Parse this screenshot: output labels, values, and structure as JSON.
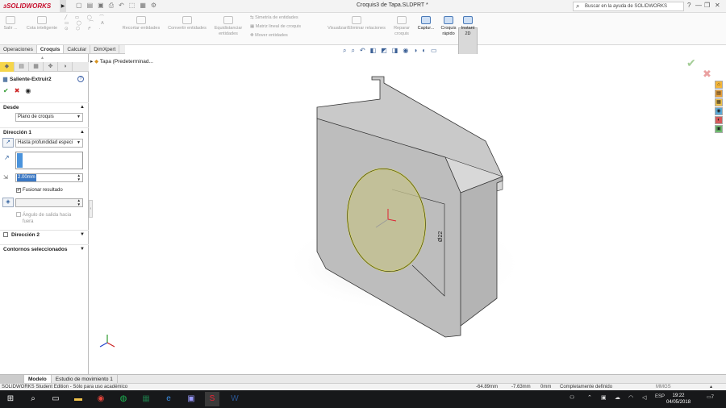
{
  "app": {
    "title": "Croquis3 de Tapa.SLDPRT *",
    "logo": "SOLIDWORKS"
  },
  "help_search": {
    "placeholder": "Buscar en la ayuda de SOLIDWORKS"
  },
  "ribbon": {
    "buttons": [
      "Salir ...",
      "Cota inteligente",
      "Recortar entidades",
      "Convertir entidades",
      "Equidistanciar entidades",
      "Simetría de entidades",
      "Matriz lineal de croquis",
      "Mover entidades",
      "Visualizar/Eliminar relaciones",
      "Reparar croquis",
      "Captur...",
      "Croquis rápido",
      "Instant 2D"
    ]
  },
  "tabs": [
    "Operaciones",
    "Croquis",
    "Calcular",
    "DimXpert"
  ],
  "active_tab": "Croquis",
  "panel": {
    "feature_title": "Saliente-Extruir2",
    "desde_label": "Desde",
    "desde_value": "Plano de croquis",
    "direccion1_label": "Dirección 1",
    "direccion1_value": "Hasta profundidad especi",
    "depth_value": "2.00mm",
    "fusionar_label": "Fusionar resultado",
    "angulo_label": "Ángulo de salida hacia fuera",
    "direccion2_label": "Dirección 2",
    "contornos_label": "Contornos seleccionados"
  },
  "tree": {
    "item": "Tapa  (Predeterminad..."
  },
  "model": {
    "dimension": "Ø22"
  },
  "bottom_tabs": [
    "Modelo",
    "Estudio de movimiento 1"
  ],
  "active_bottom_tab": "Modelo",
  "status": {
    "edition": "SOLIDWORKS Student Edition - Sólo para uso académico",
    "x": "-64.89mm",
    "y": "-7.63mm",
    "z": "0mm",
    "state": "Completamente definido",
    "units": "MMGS"
  },
  "taskbar": {
    "lang": "ESP",
    "time": "19:22",
    "date": "04/05/2018",
    "notifications": "7"
  },
  "colors": {
    "accent_red": "#c8102e",
    "selection_blue": "#4a93dc",
    "sketch_yellow": "#d6d64c"
  }
}
